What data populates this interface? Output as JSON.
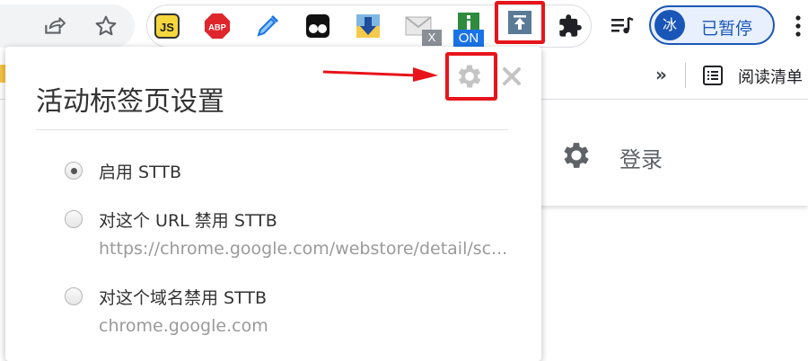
{
  "toolbar": {
    "icons": [
      "share-icon",
      "star-icon"
    ],
    "extensions": [
      {
        "name": "javascript-extension-icon",
        "label": "JS"
      },
      {
        "name": "adblock-plus-icon",
        "label": "ABP"
      },
      {
        "name": "eyedropper-icon"
      },
      {
        "name": "tampermonkey-icon"
      },
      {
        "name": "download-arrow-icon"
      },
      {
        "name": "mail-extension-icon",
        "badge": "X"
      },
      {
        "name": "info-extension-icon",
        "badge": "ON"
      },
      {
        "name": "sttb-upload-icon"
      },
      {
        "name": "puzzle-extensions-icon"
      }
    ],
    "media_icon": "playlist-music-icon",
    "profile": {
      "avatar": "冰",
      "status": "已暂停"
    }
  },
  "bookmarks": {
    "more": "»",
    "reading_list": "阅读清单"
  },
  "page": {
    "login_text": "登录"
  },
  "popup": {
    "title": "活动标签页设置",
    "options": [
      {
        "label": "启用 STTB",
        "checked": true
      },
      {
        "label": "对这个 URL 禁用 STTB",
        "sub": "https://chrome.google.com/webstore/detail/sc..."
      },
      {
        "label": "对这个域名禁用 STTB",
        "sub": "chrome.google.com"
      }
    ]
  },
  "colors": {
    "highlight": "#e8141b",
    "accent": "#1a56b8"
  }
}
